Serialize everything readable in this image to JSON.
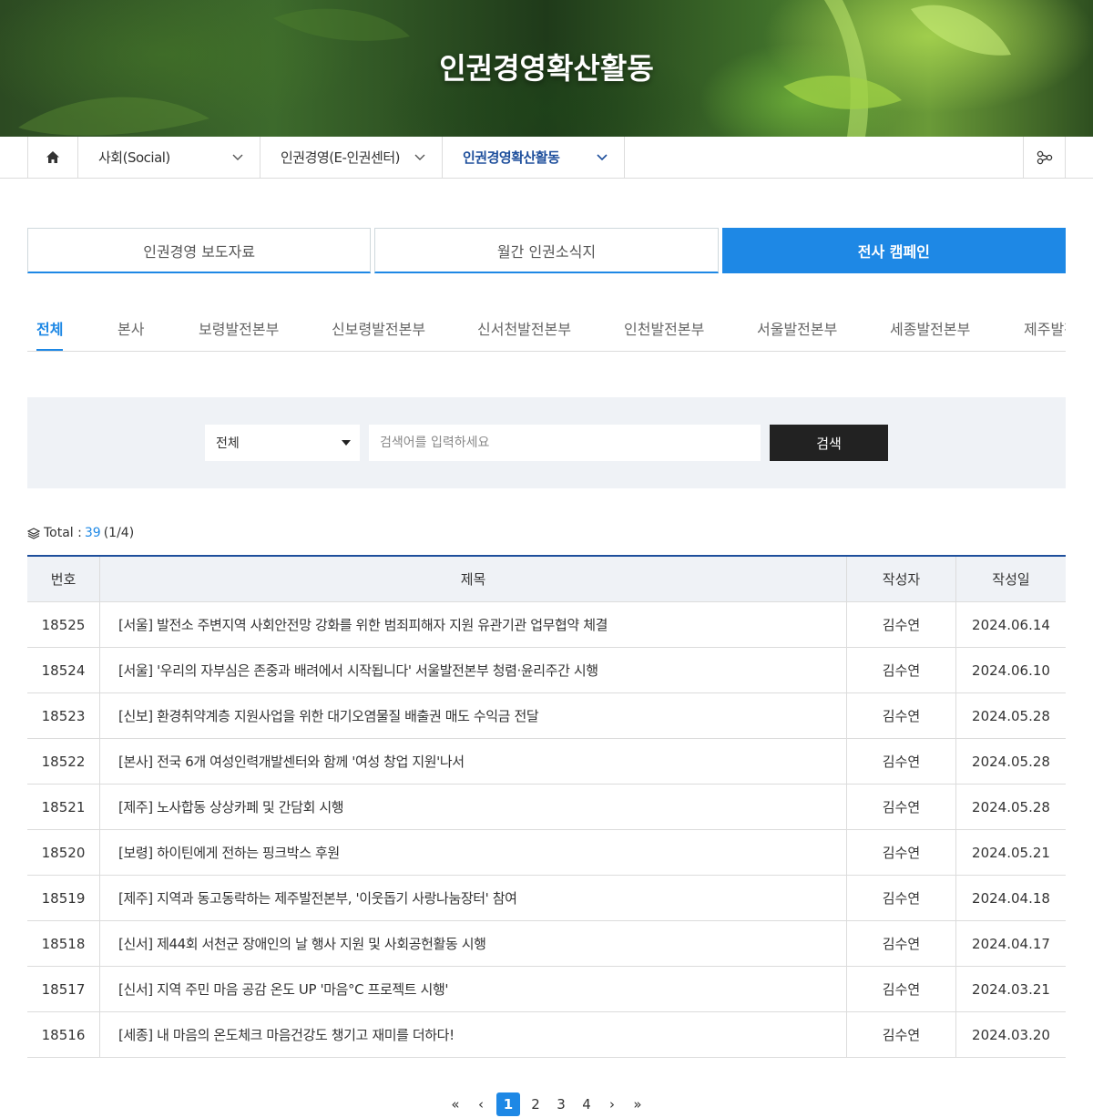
{
  "hero": {
    "title": "인권경영확산활동"
  },
  "breadcrumb": {
    "items": [
      {
        "label": "사회(Social)"
      },
      {
        "label": "인권경영(E-인권센터)"
      },
      {
        "label": "인권경영확산활동"
      }
    ]
  },
  "tabs": [
    {
      "label": "인권경영 보도자료"
    },
    {
      "label": "월간 인권소식지"
    },
    {
      "label": "전사 캠페인"
    }
  ],
  "subtabs": [
    "전체",
    "본사",
    "보령발전본부",
    "신보령발전본부",
    "신서천발전본부",
    "인천발전본부",
    "서울발전본부",
    "세종발전본부",
    "제주발전본부"
  ],
  "search": {
    "select_value": "전체",
    "placeholder": "검색어를 입력하세요",
    "button_label": "검색"
  },
  "total": {
    "label": "Total :",
    "count": "39",
    "page": "(1/4)"
  },
  "table": {
    "headers": {
      "num": "번호",
      "title": "제목",
      "author": "작성자",
      "date": "작성일"
    },
    "rows": [
      {
        "num": "18525",
        "title": "[서울] 발전소 주변지역 사회안전망 강화를 위한 범죄피해자 지원 유관기관 업무협약 체결",
        "author": "김수연",
        "date": "2024.06.14"
      },
      {
        "num": "18524",
        "title": "[서울] '우리의 자부심은 존중과 배려에서 시작됩니다' 서울발전본부 청렴·윤리주간 시행",
        "author": "김수연",
        "date": "2024.06.10"
      },
      {
        "num": "18523",
        "title": "[신보] 환경취약계층 지원사업을 위한 대기오염물질 배출권 매도 수익금 전달",
        "author": "김수연",
        "date": "2024.05.28"
      },
      {
        "num": "18522",
        "title": "[본사] 전국 6개 여성인력개발센터와 함께 '여성 창업 지원'나서",
        "author": "김수연",
        "date": "2024.05.28"
      },
      {
        "num": "18521",
        "title": "[제주] 노사합동 상상카페 및 간담회 시행",
        "author": "김수연",
        "date": "2024.05.28"
      },
      {
        "num": "18520",
        "title": "[보령] 하이틴에게 전하는 핑크박스 후원",
        "author": "김수연",
        "date": "2024.05.21"
      },
      {
        "num": "18519",
        "title": "[제주] 지역과 동고동락하는 제주발전본부, '이웃돕기 사랑나눔장터' 참여",
        "author": "김수연",
        "date": "2024.04.18"
      },
      {
        "num": "18518",
        "title": "[신서] 제44회 서천군 장애인의 날 행사 지원 및 사회공헌활동 시행",
        "author": "김수연",
        "date": "2024.04.17"
      },
      {
        "num": "18517",
        "title": "[신서] 지역 주민 마음 공감 온도 UP '마음°C 프로젝트 시행'",
        "author": "김수연",
        "date": "2024.03.21"
      },
      {
        "num": "18516",
        "title": "[세종] 내 마음의 온도체크 마음건강도 챙기고 재미를 더하다!",
        "author": "김수연",
        "date": "2024.03.20"
      }
    ]
  },
  "pagination": {
    "first": "«",
    "prev": "‹",
    "pages": [
      "1",
      "2",
      "3",
      "4"
    ],
    "next": "›",
    "last": "»",
    "current": "1"
  },
  "colors": {
    "accent": "#1e88e5",
    "dark_blue": "#1e4f9c",
    "search_bg": "#eff2f6",
    "button": "#222222"
  },
  "icons": {
    "home": "home-icon",
    "share": "share-icon",
    "layers": "layers-icon",
    "chevron": "chevron-down-icon"
  }
}
